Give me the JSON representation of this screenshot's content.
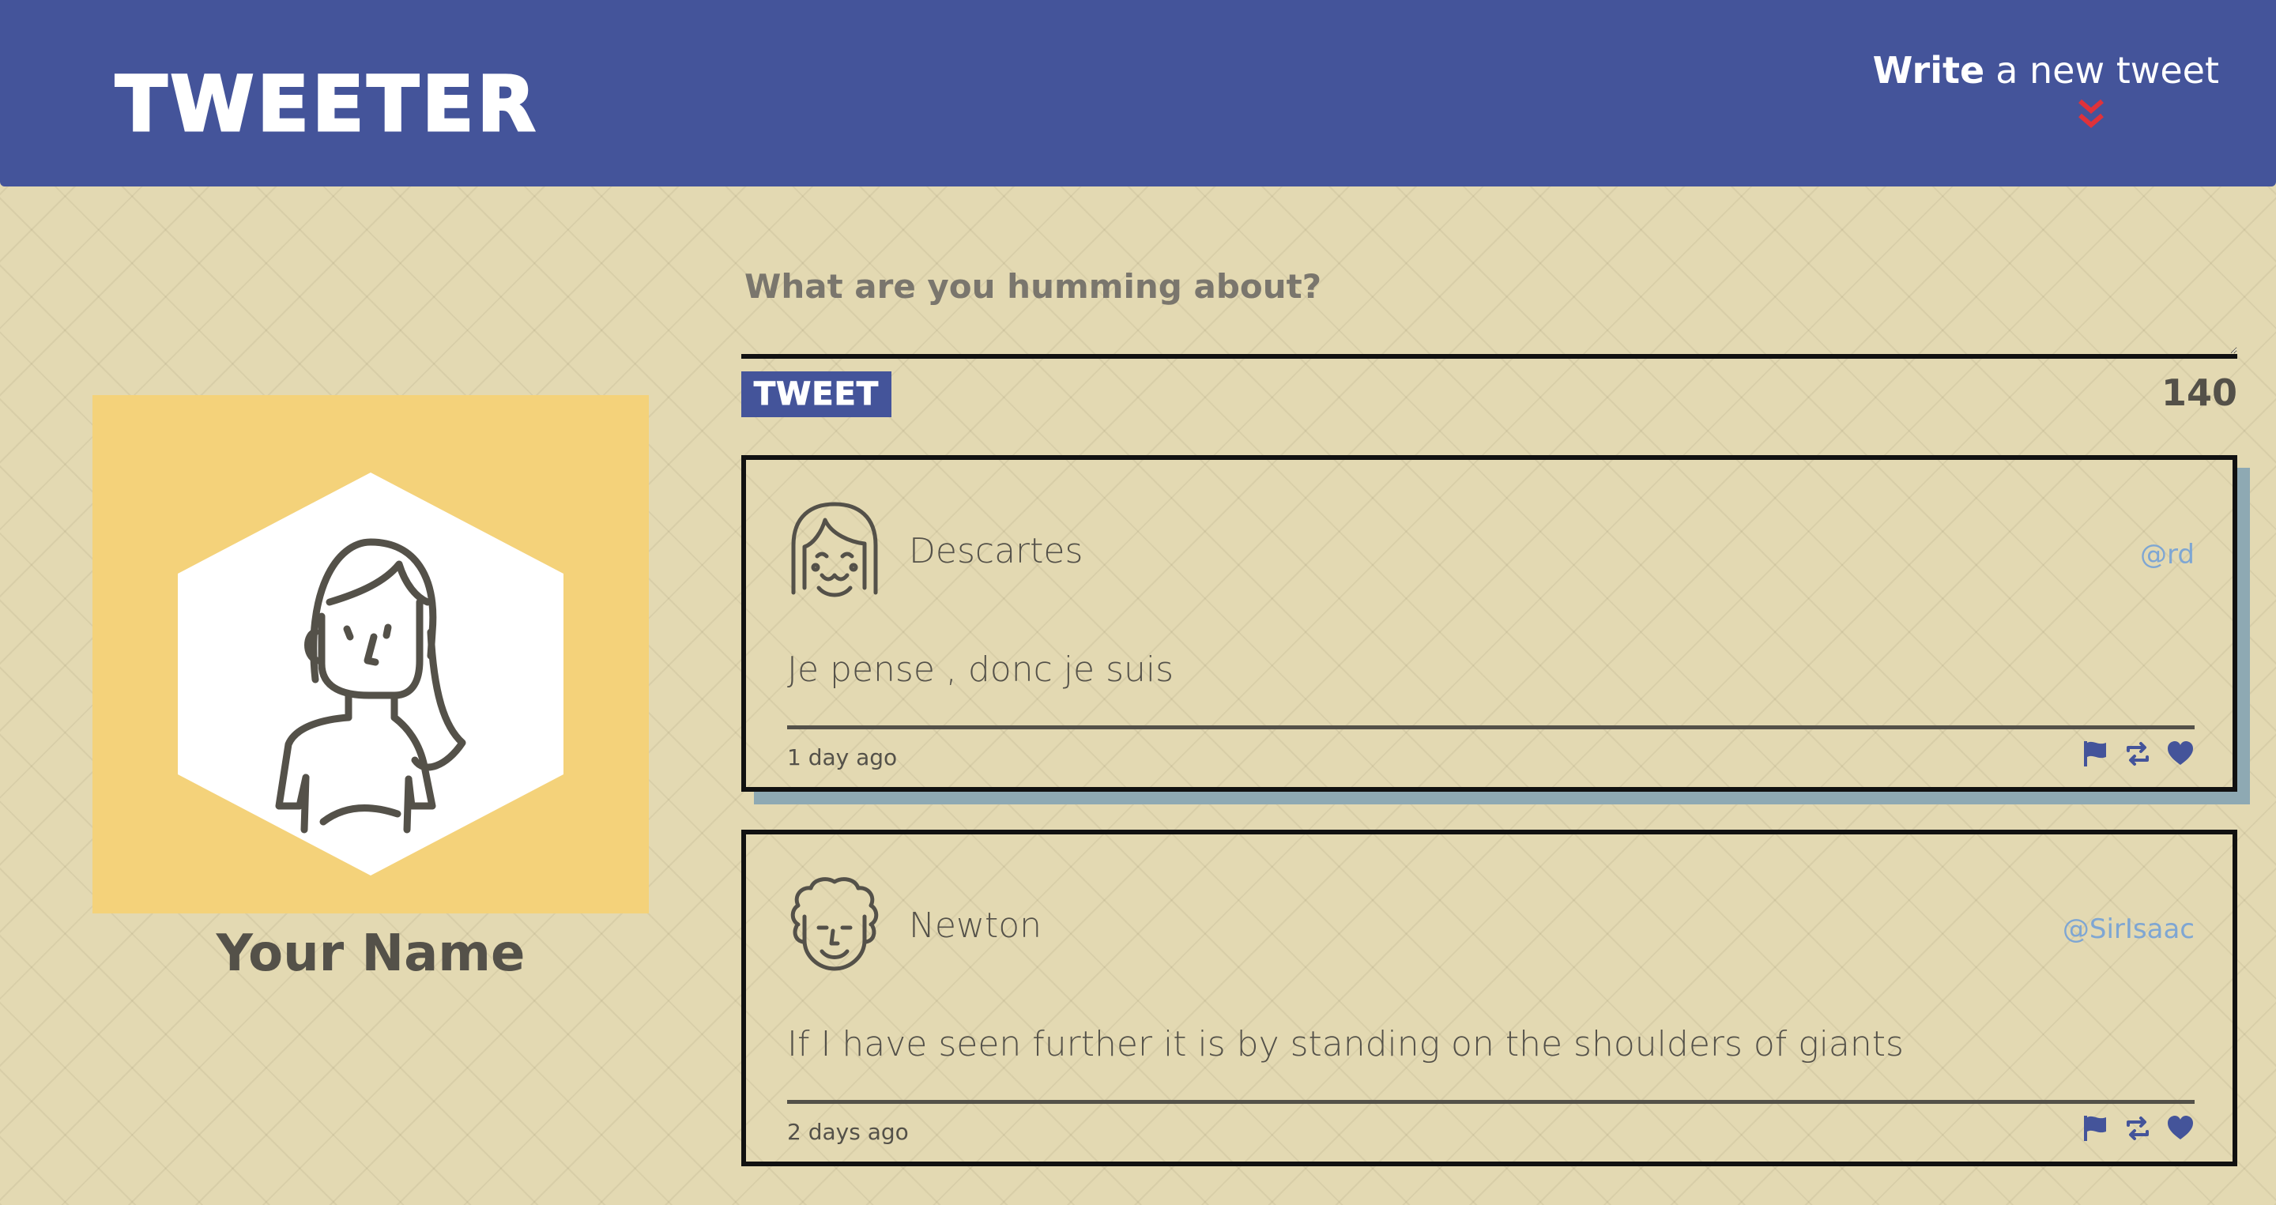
{
  "nav": {
    "brand": "TWEETER",
    "compose_bold": "Write",
    "compose_rest": "a new tweet"
  },
  "profile": {
    "name": "Your Name"
  },
  "composer": {
    "placeholder": "What are you humming about?",
    "button_label": "TWEET",
    "counter": "140"
  },
  "tweets": [
    {
      "name": "Descartes",
      "handle": "@rd",
      "text": "Je pense , donc je suis",
      "time": "1 day ago"
    },
    {
      "name": "Newton",
      "handle": "@SirIsaac",
      "text": "If I have seen further it is by standing on the shoulders of giants",
      "time": "2 days ago"
    }
  ],
  "icons": {
    "flag": "flag-icon",
    "retweet": "retweet-icon",
    "like": "heart-icon"
  },
  "colors": {
    "nav": "#44549a",
    "background": "#e3d9b2",
    "avatar_frame": "#f4d27a",
    "chevron": "#e0323a",
    "handle": "#7ea6d3",
    "tweet_shadow": "#8ea9b3"
  }
}
